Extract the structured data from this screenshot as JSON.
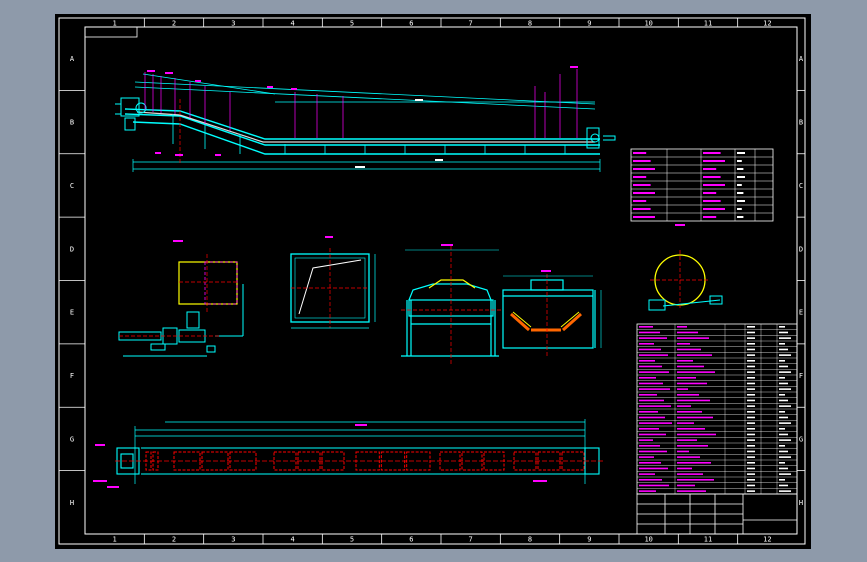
{
  "drawing": {
    "columns": [
      "1",
      "2",
      "3",
      "4",
      "5",
      "6",
      "7",
      "8",
      "9",
      "10",
      "11",
      "12"
    ],
    "rows": [
      "A",
      "B",
      "C",
      "D",
      "E",
      "F",
      "G",
      "H"
    ],
    "colors": {
      "background": "#000000",
      "frame": "#ffffff",
      "structure": "#00ffff",
      "dimension": "#ffffff",
      "annotation": "#ff00ff",
      "centerline": "#ff0000",
      "highlight": "#ffff00",
      "canvas": "#8e9aaa"
    }
  }
}
